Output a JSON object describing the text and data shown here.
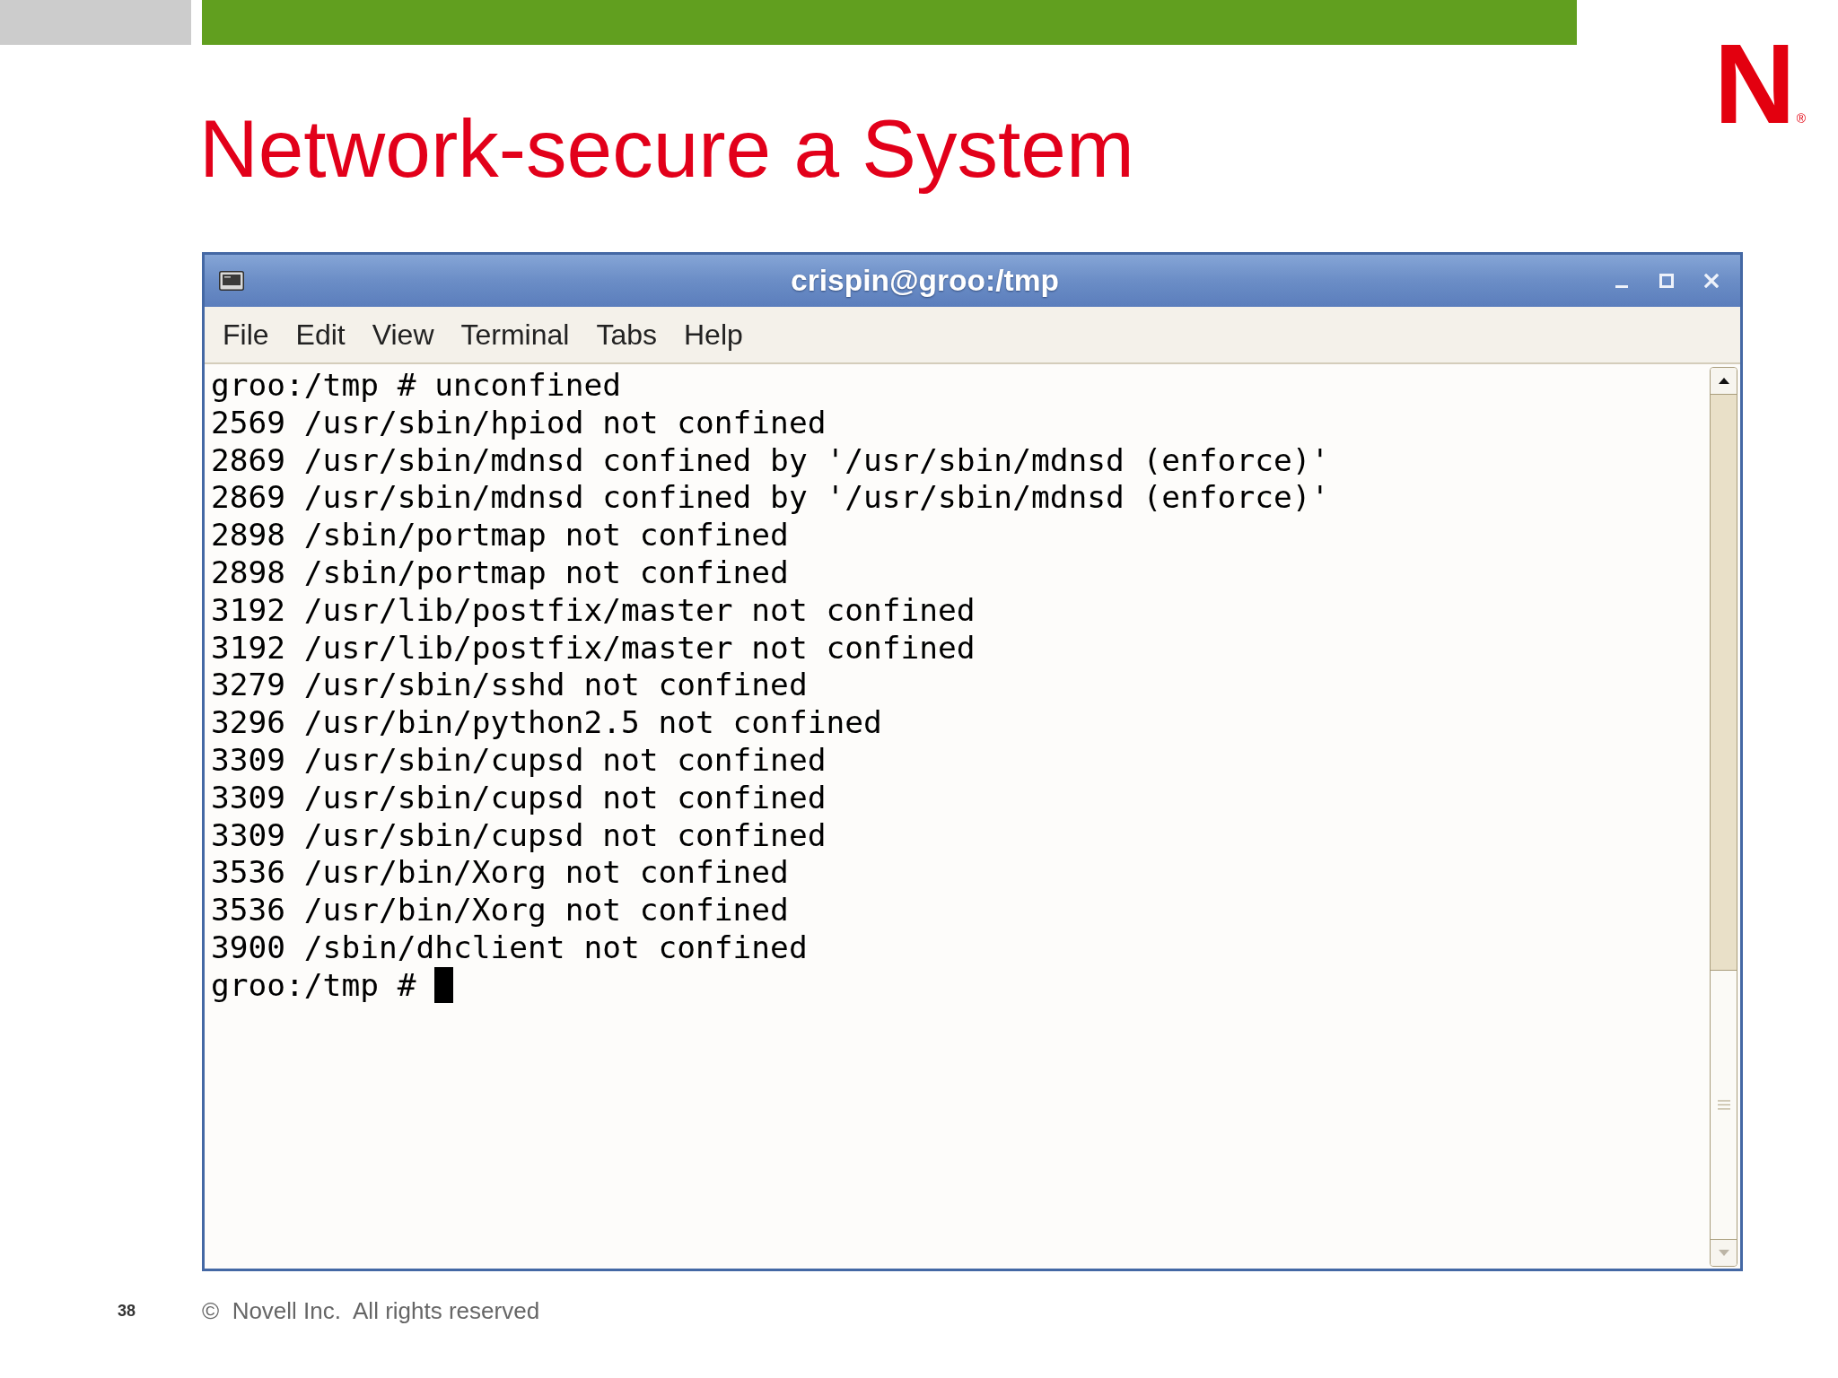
{
  "slide": {
    "title": "Network-secure a System",
    "logo": "N$_{®}$"
  },
  "window": {
    "title": "crispin@groo:/tmp",
    "controls": [
      {
        "kind": "minimize"
      },
      {
        "kind": "maximize"
      },
      {
        "kind": "close"
      }
    ]
  },
  "menu": [
    {
      "label": "File"
    },
    {
      "label": "Edit"
    },
    {
      "label": "View"
    },
    {
      "label": "Terminal"
    },
    {
      "label": "Tabs"
    },
    {
      "label": "Help"
    }
  ],
  "terminal": {
    "lines": [
      "groo:/tmp # unconfined",
      "2569 /usr/sbin/hpiod not confined",
      "2869 /usr/sbin/mdnsd confined by '/usr/sbin/mdnsd (enforce)'",
      "2869 /usr/sbin/mdnsd confined by '/usr/sbin/mdnsd (enforce)'",
      "2898 /sbin/portmap not confined",
      "2898 /sbin/portmap not confined",
      "3192 /usr/lib/postfix/master not confined",
      "3192 /usr/lib/postfix/master not confined",
      "3279 /usr/sbin/sshd not confined",
      "3296 /usr/bin/python2.5 not confined",
      "3309 /usr/sbin/cupsd not confined",
      "3309 /usr/sbin/cupsd not confined",
      "3309 /usr/sbin/cupsd not confined",
      "3536 /usr/bin/Xorg not confined",
      "3536 /usr/bin/Xorg not confined",
      "3900 /sbin/dhclient not confined"
    ],
    "prompt": "groo:/tmp #",
    "cursor": true
  },
  "scrollbar": {
    "up_disabled": false,
    "down_disabled": true
  },
  "footer": {
    "page": "38",
    "copyright": "©  Novell Inc.  All rights reserved"
  }
}
